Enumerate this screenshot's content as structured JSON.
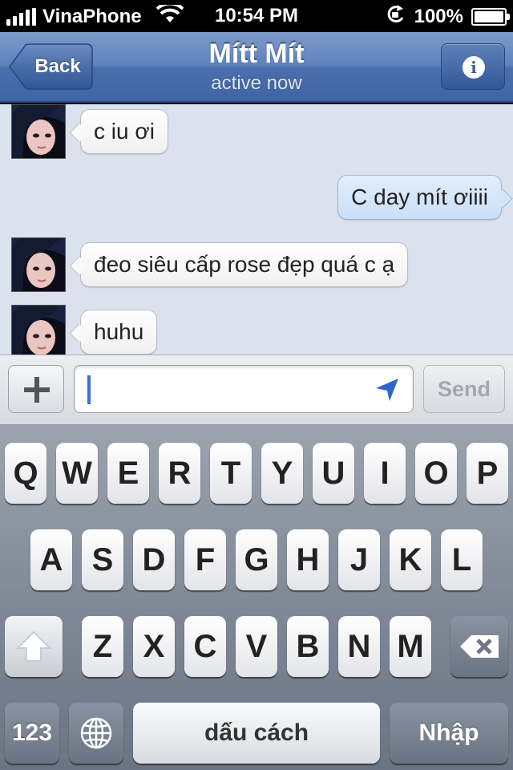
{
  "status_bar": {
    "carrier": "VinaPhone",
    "time": "10:54 PM",
    "battery": "100%",
    "battery_level": 1.0,
    "icons": [
      "signal-bars-icon",
      "wifi-icon",
      "rotation-lock-icon",
      "battery-icon"
    ]
  },
  "nav": {
    "back_label": "Back",
    "title": "Mítt Mít",
    "subtitle": "active now",
    "info_icon_glyph": "i"
  },
  "messages": [
    {
      "direction": "incoming",
      "text": "c iu ơi"
    },
    {
      "direction": "outgoing",
      "text": "C day mít ơiiii"
    },
    {
      "direction": "incoming",
      "text": "đeo siêu cấp rose đẹp quá c ạ"
    },
    {
      "direction": "incoming",
      "text": "huhu"
    }
  ],
  "composer": {
    "value": "",
    "send_label": "Send",
    "icons": [
      "plus-icon",
      "location-arrow-icon"
    ]
  },
  "keyboard": {
    "row1": [
      "Q",
      "W",
      "E",
      "R",
      "T",
      "Y",
      "U",
      "I",
      "O",
      "P"
    ],
    "row2": [
      "A",
      "S",
      "D",
      "F",
      "G",
      "H",
      "J",
      "K",
      "L"
    ],
    "row3": [
      "Z",
      "X",
      "C",
      "V",
      "B",
      "N",
      "M"
    ],
    "numbers_label": "123",
    "space_label": "dấu cách",
    "return_label": "Nhập",
    "icons": [
      "shift-icon",
      "delete-icon",
      "globe-icon"
    ]
  },
  "colors": {
    "nav_blue": "#4b6fae",
    "chat_background": "#dbe2ed",
    "outgoing_bubble": "#c9dff7",
    "caret_blue": "#3b6fe0"
  }
}
